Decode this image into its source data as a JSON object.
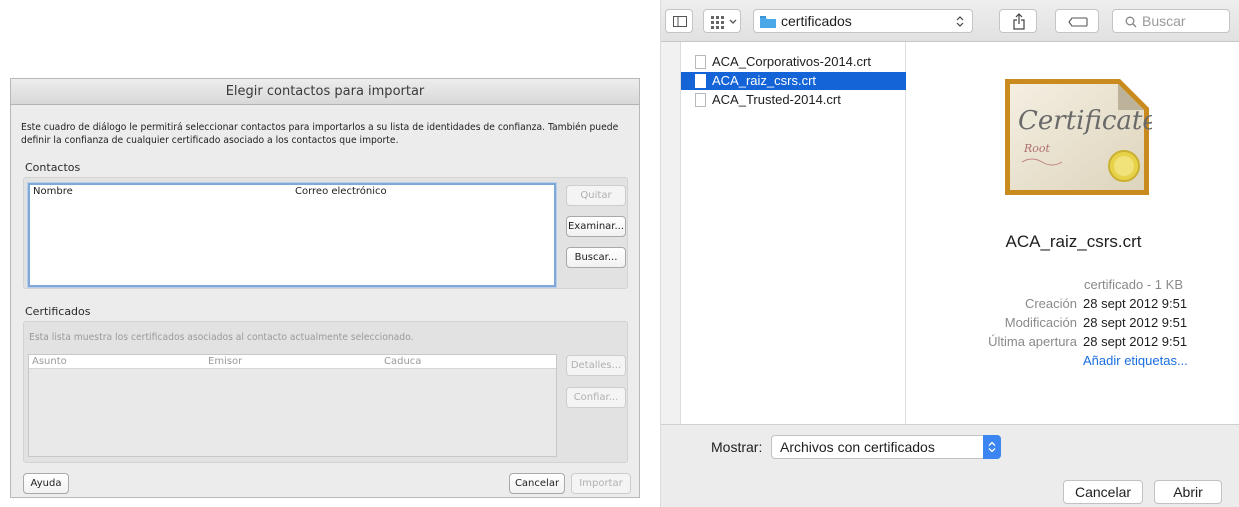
{
  "import_dialog": {
    "title": "Elegir contactos para importar",
    "description": "Este cuadro de diálogo le permitirá seleccionar contactos para importarlos a su lista de identidades de confianza. También puede definir la confianza de cualquier certificado asociado a los contactos que importe.",
    "contacts": {
      "label": "Contactos",
      "columns": [
        "Nombre",
        "Correo electrónico"
      ],
      "buttons": {
        "remove": "Quitar",
        "browse": "Examinar...",
        "search": "Buscar..."
      }
    },
    "certificates": {
      "label": "Certificados",
      "hint": "Esta lista muestra los certificados asociados al contacto actualmente seleccionado.",
      "columns": [
        "Asunto",
        "Emisor",
        "Caduca"
      ],
      "buttons": {
        "details": "Detalles...",
        "trust": "Confiar..."
      }
    },
    "footer": {
      "help": "Ayuda",
      "cancel": "Cancelar",
      "import": "Importar"
    }
  },
  "file_chooser": {
    "location": "certificados",
    "search_placeholder": "Buscar",
    "files": [
      {
        "name": "ACA_Corporativos-2014.crt",
        "selected": false
      },
      {
        "name": "ACA_raiz_csrs.crt",
        "selected": true
      },
      {
        "name": "ACA_Trusted-2014.crt",
        "selected": false
      }
    ],
    "preview": {
      "thumbnail_title": "Certificate",
      "thumbnail_subtitle": "Root",
      "file_name": "ACA_raiz_csrs.crt",
      "kind": "certificado - 1 KB",
      "created_label": "Creación",
      "created_value": "28 sept 2012 9:51",
      "modified_label": "Modificación",
      "modified_value": "28 sept 2012 9:51",
      "opened_label": "Última apertura",
      "opened_value": "28 sept 2012 9:51",
      "add_tags": "Añadir etiquetas..."
    },
    "show_label": "Mostrar:",
    "filter_value": "Archivos con certificados",
    "buttons": {
      "cancel": "Cancelar",
      "open": "Abrir"
    }
  },
  "colors": {
    "selection": "#1464d8",
    "link": "#1a6fe0",
    "folder": "#4aa8e8",
    "seal": "#e8d24a"
  }
}
